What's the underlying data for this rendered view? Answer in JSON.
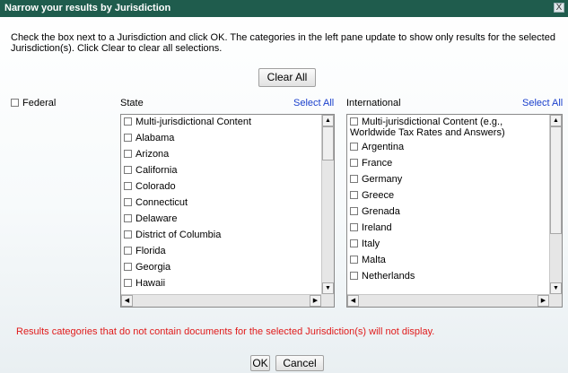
{
  "dialog": {
    "title": "Narrow your results by Jurisdiction",
    "close_label": "X",
    "instructions": "Check the box next to a Jurisdiction and click OK. The categories in the left pane update to show only results for the selected Jurisdiction(s). Click Clear to clear all selections.",
    "clear_all_label": "Clear All",
    "federal_label": "Federal",
    "warning": "Results categories that do not contain documents for the selected Jurisdiction(s) will not display.",
    "ok_label": "OK",
    "cancel_label": "Cancel"
  },
  "state": {
    "label": "State",
    "select_all": "Select All",
    "items": [
      "Multi-jurisdictional Content",
      "Alabama",
      "Arizona",
      "California",
      "Colorado",
      "Connecticut",
      "Delaware",
      "District of Columbia",
      "Florida",
      "Georgia",
      "Hawaii"
    ]
  },
  "international": {
    "label": "International",
    "select_all": "Select All",
    "items": [
      "Multi-jurisdictional Content (e.g., Worldwide Tax Rates and Answers)",
      "Argentina",
      "France",
      "Germany",
      "Greece",
      "Grenada",
      "Ireland",
      "Italy",
      "Malta",
      "Netherlands"
    ]
  },
  "colors": {
    "titlebar": "#1f5c4d",
    "link": "#1a3fcc",
    "warning": "#e01b1b"
  }
}
